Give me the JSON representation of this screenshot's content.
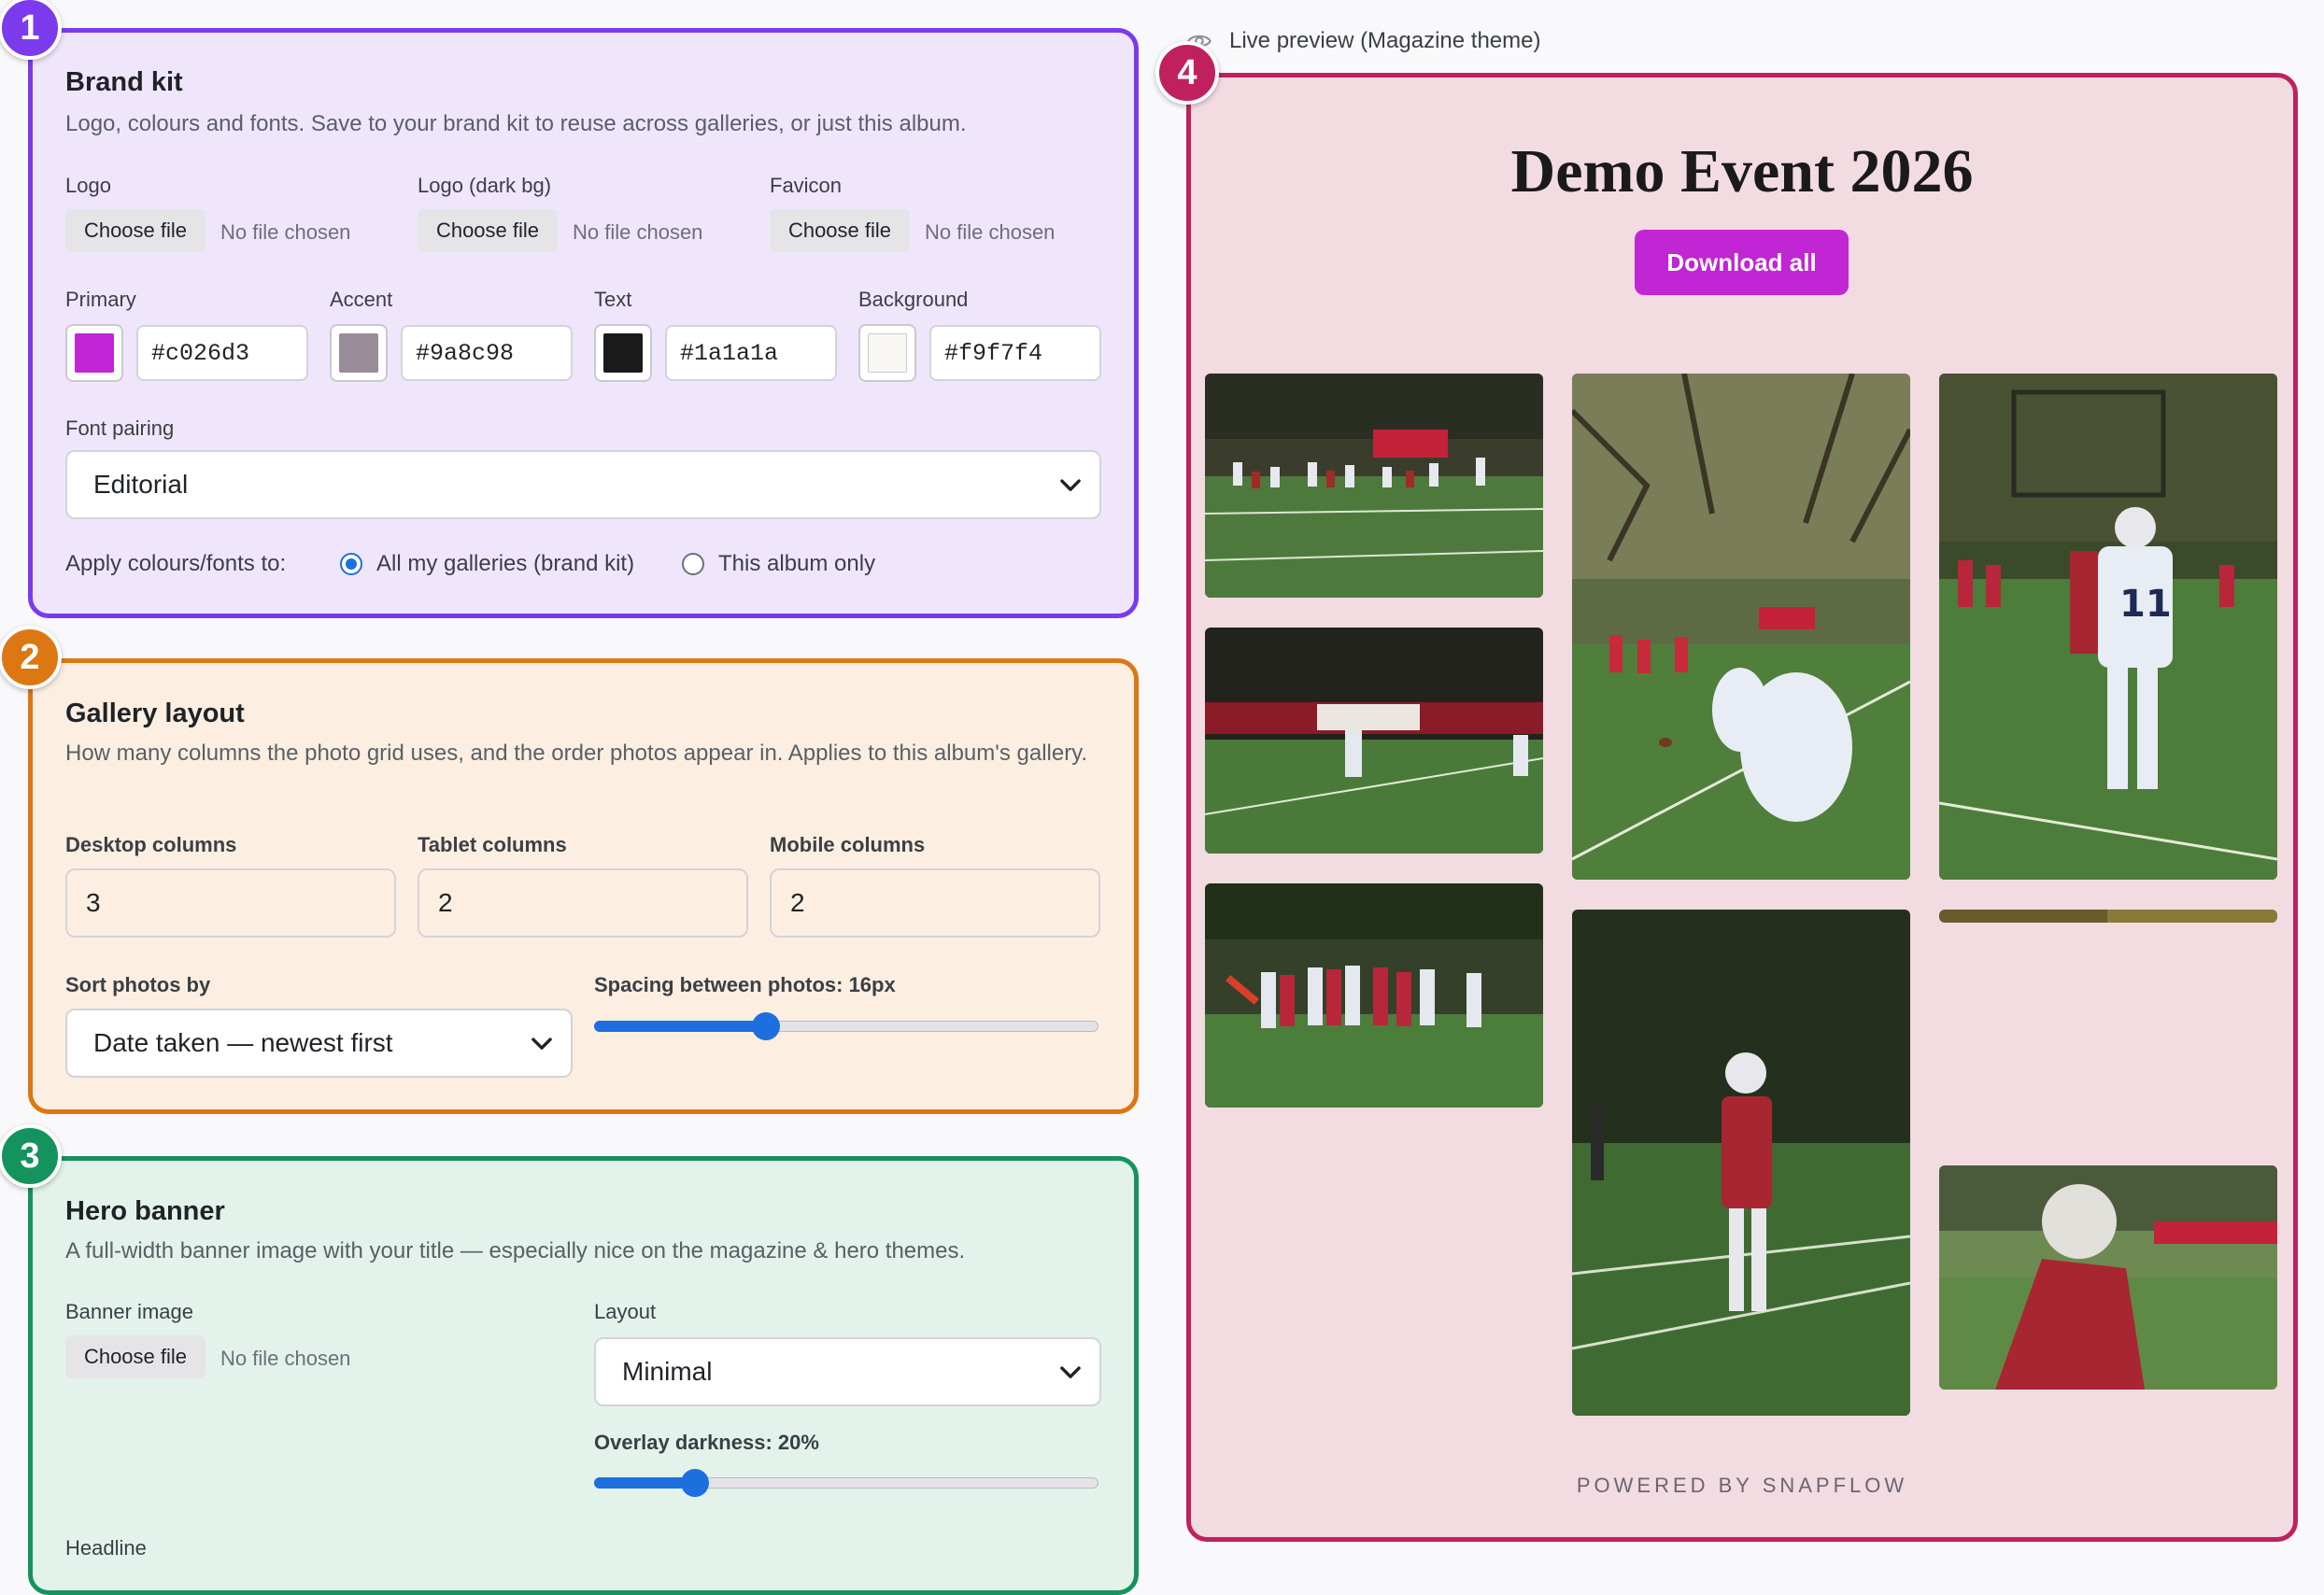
{
  "brand_kit": {
    "badge": "1",
    "title": "Brand kit",
    "description": "Logo, colours and fonts. Save to your brand kit to reuse across galleries, or just this album.",
    "files": [
      {
        "label": "Logo",
        "button": "Choose file",
        "status": "No file chosen"
      },
      {
        "label": "Logo (dark bg)",
        "button": "Choose file",
        "status": "No file chosen"
      },
      {
        "label": "Favicon",
        "button": "Choose file",
        "status": "No file chosen"
      }
    ],
    "colors": [
      {
        "label": "Primary",
        "value": "#c026d3"
      },
      {
        "label": "Accent",
        "value": "#9a8c98"
      },
      {
        "label": "Text",
        "value": "#1a1a1a"
      },
      {
        "label": "Background",
        "value": "#f9f7f4"
      }
    ],
    "font_pairing_label": "Font pairing",
    "font_pairing_value": "Editorial",
    "apply_label": "Apply colours/fonts to:",
    "apply_options": [
      {
        "label": "All my galleries (brand kit)",
        "checked": true
      },
      {
        "label": "This album only",
        "checked": false
      }
    ]
  },
  "gallery_layout": {
    "badge": "2",
    "title": "Gallery layout",
    "description": "How many columns the photo grid uses, and the order photos appear in. Applies to this album's gallery.",
    "columns": [
      {
        "label": "Desktop columns",
        "value": "3"
      },
      {
        "label": "Tablet columns",
        "value": "2"
      },
      {
        "label": "Mobile columns",
        "value": "2"
      }
    ],
    "sort_label": "Sort photos by",
    "sort_value": "Date taken — newest first",
    "spacing_label": "Spacing between photos: 16px",
    "spacing_level": 0.34
  },
  "hero_banner": {
    "badge": "3",
    "title": "Hero banner",
    "description": "A full-width banner image with your title — especially nice on the magazine & hero themes.",
    "banner_label": "Banner image",
    "banner_button": "Choose file",
    "banner_status": "No file chosen",
    "layout_label": "Layout",
    "layout_value": "Minimal",
    "overlay_label": "Overlay darkness: 20%",
    "overlay_level": 0.2,
    "headline_label": "Headline"
  },
  "preview": {
    "badge": "4",
    "caption": "Live preview (Magazine theme)",
    "event_title": "Demo Event 2026",
    "download_label": "Download all",
    "powered_by": "POWERED BY SNAPFLOW",
    "colors": {
      "panel_bg": "#f3dbe2",
      "button": "#c026d3",
      "border": "#c0215e"
    }
  }
}
